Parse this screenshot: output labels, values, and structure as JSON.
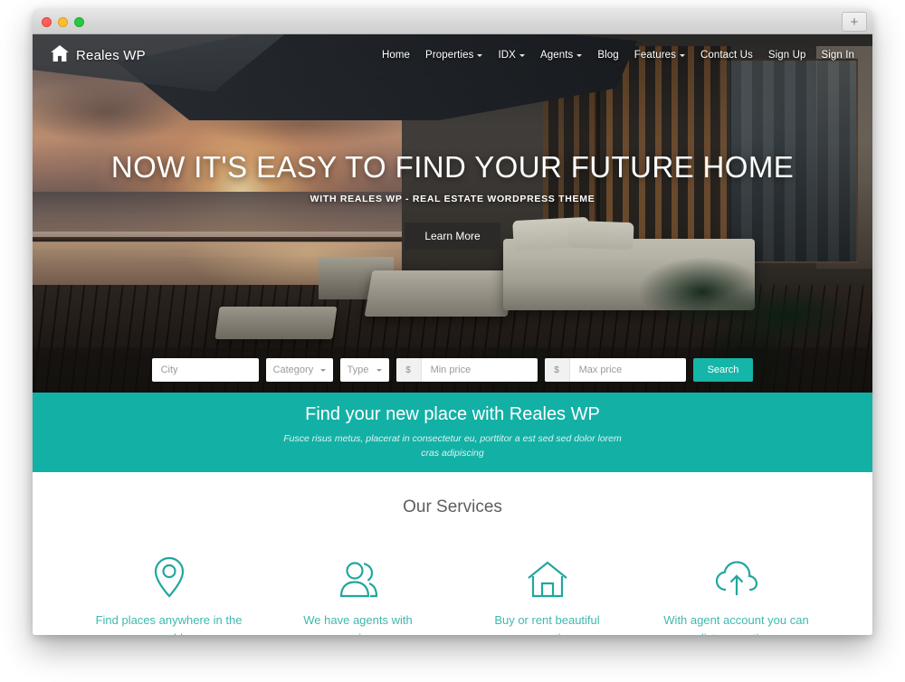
{
  "browser": {
    "traffic_lights": [
      "close",
      "minimize",
      "zoom"
    ],
    "new_tab_label": "+"
  },
  "site": {
    "brand": {
      "name": "Reales WP",
      "icon": "home-icon"
    },
    "nav": [
      {
        "label": "Home",
        "has_dropdown": false
      },
      {
        "label": "Properties",
        "has_dropdown": true
      },
      {
        "label": "IDX",
        "has_dropdown": true
      },
      {
        "label": "Agents",
        "has_dropdown": true
      },
      {
        "label": "Blog",
        "has_dropdown": false
      },
      {
        "label": "Features",
        "has_dropdown": true
      },
      {
        "label": "Contact Us",
        "has_dropdown": false
      },
      {
        "label": "Sign Up",
        "has_dropdown": false
      },
      {
        "label": "Sign In",
        "has_dropdown": false
      }
    ]
  },
  "hero": {
    "title": "NOW IT'S EASY TO FIND YOUR FUTURE HOME",
    "subtitle": "WITH REALES WP - REAL ESTATE WORDPRESS THEME",
    "cta_label": "Learn More"
  },
  "search": {
    "city_placeholder": "City",
    "category_label": "Category",
    "type_label": "Type",
    "currency_symbol": "$",
    "min_price_placeholder": "Min price",
    "max_price_placeholder": "Max price",
    "button_label": "Search"
  },
  "banner": {
    "title": "Find your new place with Reales WP",
    "subtitle": "Fusce risus metus, placerat in consectetur eu, porttitor a est sed sed dolor lorem cras adipiscing"
  },
  "services": {
    "title": "Our Services",
    "items": [
      {
        "icon": "map-pin-icon",
        "caption": "Find places anywhere in the world"
      },
      {
        "icon": "people-icon",
        "caption": "We have agents with experience"
      },
      {
        "icon": "house-icon",
        "caption": "Buy or rent beautiful properties"
      },
      {
        "icon": "cloud-upload-icon",
        "caption": "With agent account you can list properties"
      }
    ]
  },
  "colors": {
    "teal": "#13b0a5",
    "teal_button": "#16b5a9",
    "service_text": "#3fb9b0",
    "heading_gray": "#5e5e5e"
  }
}
